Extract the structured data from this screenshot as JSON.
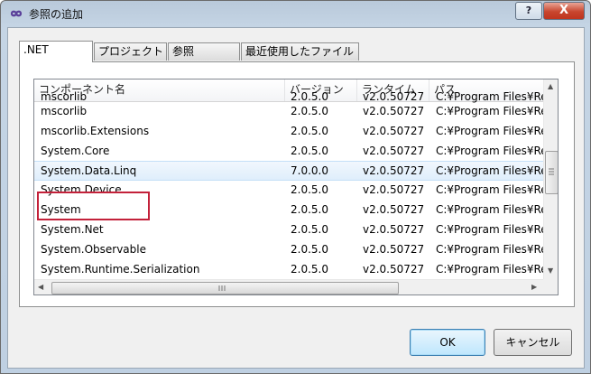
{
  "window": {
    "title": "参照の追加"
  },
  "titlebar": {
    "help_label": "?",
    "close_label": "X"
  },
  "tabs": [
    {
      "label": ".NET",
      "active": true
    },
    {
      "label": "プロジェクト",
      "active": false
    },
    {
      "label": "参照",
      "active": false
    },
    {
      "label": "最近使用したファイル",
      "active": false
    }
  ],
  "list": {
    "columns": [
      "コンポーネント名",
      "バージョン",
      "ランタイム",
      "パス"
    ],
    "partial_top_row": [
      "mscorlib",
      "2.0.5.0",
      "v2.0.50727",
      "C:¥Program Files¥Re"
    ],
    "rows": [
      [
        "mscorlib",
        "2.0.5.0",
        "v2.0.50727",
        "C:¥Program Files¥Re"
      ],
      [
        "mscorlib.Extensions",
        "2.0.5.0",
        "v2.0.50727",
        "C:¥Program Files¥Re"
      ],
      [
        "System.Core",
        "2.0.5.0",
        "v2.0.50727",
        "C:¥Program Files¥Re"
      ],
      [
        "System.Data.Linq",
        "7.0.0.0",
        "v2.0.50727",
        "C:¥Program Files¥Re"
      ],
      [
        "System.Device",
        "2.0.5.0",
        "v2.0.50727",
        "C:¥Program Files¥Re"
      ],
      [
        "System",
        "2.0.5.0",
        "v2.0.50727",
        "C:¥Program Files¥Re"
      ],
      [
        "System.Net",
        "2.0.5.0",
        "v2.0.50727",
        "C:¥Program Files¥Re"
      ],
      [
        "System.Observable",
        "2.0.5.0",
        "v2.0.50727",
        "C:¥Program Files¥Re"
      ],
      [
        "System.Runtime.Serialization",
        "2.0.5.0",
        "v2.0.50727",
        "C:¥Program Files¥Re"
      ]
    ],
    "selected_row": "System.Data.Linq"
  },
  "buttons": {
    "ok": "OK",
    "cancel": "キャンセル"
  },
  "colors": {
    "highlight_box": "#c3213a",
    "selection": "#dfeefc"
  }
}
